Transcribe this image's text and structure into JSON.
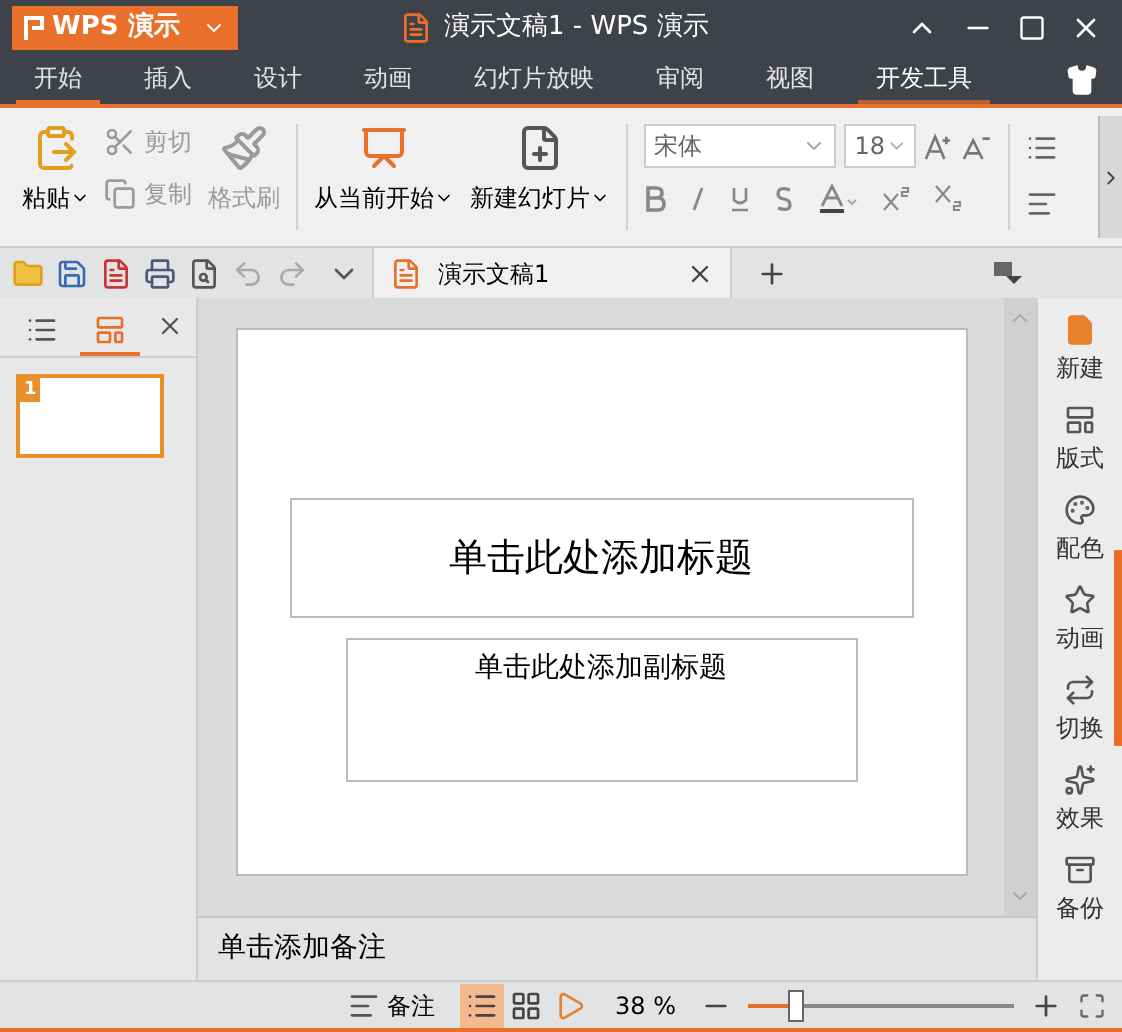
{
  "app_menu": {
    "label": "WPS 演示"
  },
  "window": {
    "title": "演示文稿1 - WPS 演示"
  },
  "tabs": [
    {
      "label": "开始",
      "selected": true,
      "hover": false
    },
    {
      "label": "插入",
      "selected": false,
      "hover": false
    },
    {
      "label": "设计",
      "selected": false,
      "hover": false
    },
    {
      "label": "动画",
      "selected": false,
      "hover": false
    },
    {
      "label": "幻灯片放映",
      "selected": false,
      "hover": false
    },
    {
      "label": "审阅",
      "selected": false,
      "hover": false
    },
    {
      "label": "视图",
      "selected": false,
      "hover": false
    },
    {
      "label": "开发工具",
      "selected": false,
      "hover": true
    }
  ],
  "ribbon": {
    "paste": {
      "label": "粘贴"
    },
    "cut": {
      "label": "剪切",
      "disabled": true
    },
    "copy": {
      "label": "复制",
      "disabled": true
    },
    "format_painter": {
      "label": "格式刷",
      "disabled": true
    },
    "from_current": {
      "label": "从当前开始"
    },
    "new_slide": {
      "label": "新建幻灯片"
    },
    "font_name": "宋体",
    "font_size": "18"
  },
  "document_tab": {
    "title": "演示文稿1"
  },
  "outline_pane": {
    "tabs": [
      {
        "kind": "outline",
        "selected": false
      },
      {
        "kind": "slides",
        "selected": true
      }
    ],
    "thumbnails": [
      {
        "number": "1",
        "selected": true
      }
    ]
  },
  "slide": {
    "title_placeholder": "单击此处添加标题",
    "subtitle_placeholder": "单击此处添加副标题"
  },
  "notes": {
    "placeholder": "单击添加备注"
  },
  "task_pane": [
    {
      "kind": "new",
      "label": "新建"
    },
    {
      "kind": "layout",
      "label": "版式"
    },
    {
      "kind": "color",
      "label": "配色"
    },
    {
      "kind": "animation",
      "label": "动画"
    },
    {
      "kind": "transition",
      "label": "切换"
    },
    {
      "kind": "effect",
      "label": "效果"
    },
    {
      "kind": "backup",
      "label": "备份"
    }
  ],
  "status_bar": {
    "notes_button": "备注",
    "views": [
      {
        "kind": "normal",
        "selected": true
      },
      {
        "kind": "sorter",
        "selected": false
      },
      {
        "kind": "show",
        "selected": false
      }
    ],
    "zoom": "38 %",
    "zoom_slider": {
      "level": 0.16
    }
  }
}
